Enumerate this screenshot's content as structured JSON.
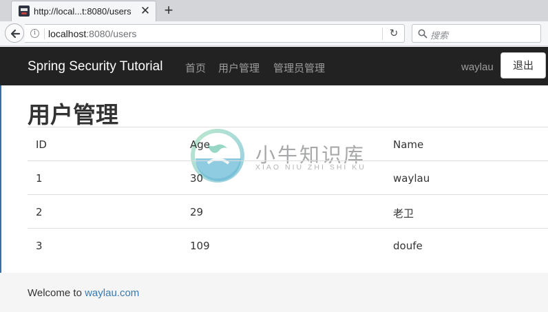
{
  "browser": {
    "tab_title": "http://local...t:8080/users",
    "url_host": "localhost",
    "url_rest": ":8080/users",
    "search_placeholder": "搜索"
  },
  "nav": {
    "brand": "Spring Security Tutorial",
    "links": [
      "首页",
      "用户管理",
      "管理员管理"
    ],
    "username": "waylau",
    "logout_label": "退出"
  },
  "main": {
    "title": "用户管理",
    "table": {
      "headers": [
        "ID",
        "Age",
        "Name"
      ],
      "rows": [
        [
          "1",
          "30",
          "waylau"
        ],
        [
          "2",
          "29",
          "老卫"
        ],
        [
          "3",
          "109",
          "doufe"
        ]
      ]
    }
  },
  "footer": {
    "prefix": "Welcome to ",
    "link": "waylau.com"
  },
  "watermark": {
    "title": "小牛知识库",
    "subtitle": "XIAO NIU ZHI SHI KU"
  },
  "colors": {
    "navbar": "#222222",
    "link": "#337ab7",
    "footer_bg": "#f5f5f5"
  }
}
